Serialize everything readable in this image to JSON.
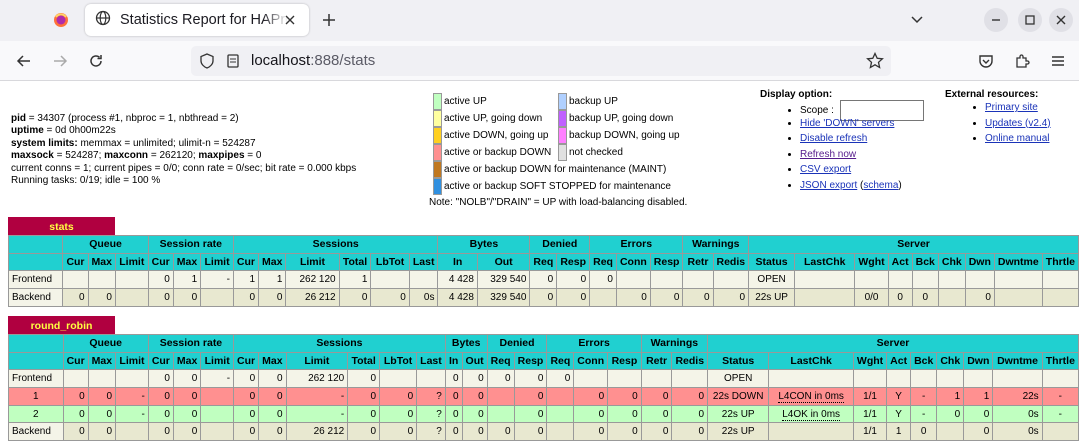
{
  "browser": {
    "tab_title": "Statistics Report for HAProxy",
    "url_host": "localhost",
    "url_rest": ":888/stats"
  },
  "info_lines": [
    {
      "b": "pid",
      "t": " = 34307 (process #1, nbproc = 1, nbthread = 2)"
    },
    {
      "b": "uptime",
      "t": " = 0d 0h00m22s"
    },
    {
      "b": "system limits:",
      "t": " memmax = unlimited; ulimit-n = 524287"
    },
    {
      "b": "maxsock",
      "t": " = 524287; ",
      "b2": "maxconn",
      "t2": " = 262120; ",
      "b3": "maxpipes",
      "t3": " = 0"
    },
    {
      "t": "current conns = 1; current pipes = 0/0; conn rate = 0/sec; bit rate = 0.000 kbps"
    },
    {
      "t": "Running tasks: 0/19; idle = 100 %"
    }
  ],
  "legend_left": [
    {
      "label": "active UP",
      "color": "#c0ffc0"
    },
    {
      "label": "active UP, going down",
      "color": "#ffffa0"
    },
    {
      "label": "active DOWN, going up",
      "color": "#ffd020"
    },
    {
      "label": "active or backup DOWN",
      "color": "#ff9090"
    },
    {
      "label": "active or backup DOWN for maintenance (MAINT)",
      "color": "#c07820"
    },
    {
      "label": "active or backup SOFT STOPPED for maintenance",
      "color": "#3090e0"
    }
  ],
  "legend_right": [
    {
      "label": "backup UP",
      "color": "#b0d0ff"
    },
    {
      "label": "backup UP, going down",
      "color": "#c060ff"
    },
    {
      "label": "backup DOWN, going up",
      "color": "#ff80ff"
    },
    {
      "label": "not checked",
      "color": "#e0e0e0"
    }
  ],
  "note": "Note: \"NOLB\"/\"DRAIN\" = UP with load-balancing disabled.",
  "display": {
    "title": "Display option:",
    "scope_label": "Scope : ",
    "links": [
      "Hide 'DOWN' servers",
      "Disable refresh",
      "Refresh now",
      "CSV export",
      "JSON export"
    ],
    "schema": "schema"
  },
  "external": {
    "title": "External resources:",
    "links": [
      "Primary site",
      "Updates (v2.4)",
      "Online manual"
    ]
  },
  "stats": {
    "name": "stats",
    "groups": [
      "",
      "Queue",
      "Session rate",
      "Sessions",
      "Bytes",
      "Denied",
      "Errors",
      "Warnings",
      "Server"
    ],
    "cols": [
      "",
      "Cur",
      "Max",
      "Limit",
      "Cur",
      "Max",
      "Limit",
      "Cur",
      "Max",
      "Limit",
      "Total",
      "LbTot",
      "Last",
      "In",
      "Out",
      "Req",
      "Resp",
      "Req",
      "Conn",
      "Resp",
      "Retr",
      "Redis",
      "Status",
      "LastChk",
      "Wght",
      "Act",
      "Bck",
      "Chk",
      "Dwn",
      "Dwntme",
      "Thrtle"
    ],
    "rows": [
      {
        "cls": "fe",
        "cells": [
          "Frontend",
          "",
          "",
          "",
          "0",
          "1",
          "-",
          "1",
          "1",
          "262 120",
          "1",
          "",
          "",
          "4 428",
          "329 540",
          "0",
          "0",
          "0",
          "",
          "",
          "",
          "",
          "OPEN",
          "",
          "",
          "",
          "",
          "",
          "",
          "",
          ""
        ]
      },
      {
        "cls": "be",
        "cells": [
          "Backend",
          "0",
          "0",
          "",
          "0",
          "0",
          "",
          "0",
          "0",
          "26 212",
          "0",
          "0",
          "0s",
          "4 428",
          "329 540",
          "0",
          "0",
          "",
          "0",
          "0",
          "0",
          "0",
          "22s UP",
          "",
          "0/0",
          "0",
          "0",
          "",
          "0",
          "",
          ""
        ]
      }
    ]
  },
  "rr": {
    "name": "round_robin",
    "groups": [
      "",
      "Queue",
      "Session rate",
      "Sessions",
      "Bytes",
      "Denied",
      "Errors",
      "Warnings",
      "Server"
    ],
    "cols": [
      "",
      "Cur",
      "Max",
      "Limit",
      "Cur",
      "Max",
      "Limit",
      "Cur",
      "Max",
      "Limit",
      "Total",
      "LbTot",
      "Last",
      "In",
      "Out",
      "Req",
      "Resp",
      "Req",
      "Conn",
      "Resp",
      "Retr",
      "Redis",
      "Status",
      "LastChk",
      "Wght",
      "Act",
      "Bck",
      "Chk",
      "Dwn",
      "Dwntme",
      "Thrtle"
    ],
    "rows": [
      {
        "cls": "fe",
        "cells": [
          "Frontend",
          "",
          "",
          "",
          "0",
          "0",
          "-",
          "0",
          "0",
          "262 120",
          "0",
          "",
          "",
          "0",
          "0",
          "0",
          "0",
          "0",
          "",
          "",
          "",
          "",
          "OPEN",
          "",
          "",
          "",
          "",
          "",
          "",
          "",
          ""
        ]
      },
      {
        "cls": "down",
        "cells": [
          "1",
          "0",
          "0",
          "-",
          "0",
          "0",
          "",
          "0",
          "0",
          "-",
          "0",
          "0",
          "?",
          "0",
          "0",
          "",
          "0",
          "",
          "0",
          "0",
          "0",
          "0",
          "22s DOWN",
          "L4CON in 0ms",
          "1/1",
          "Y",
          "-",
          "1",
          "1",
          "22s",
          "-"
        ]
      },
      {
        "cls": "up",
        "cells": [
          "2",
          "0",
          "0",
          "-",
          "0",
          "0",
          "",
          "0",
          "0",
          "-",
          "0",
          "0",
          "?",
          "0",
          "0",
          "",
          "0",
          "",
          "0",
          "0",
          "0",
          "0",
          "22s UP",
          "L4OK in 0ms",
          "1/1",
          "Y",
          "-",
          "0",
          "0",
          "0s",
          "-"
        ]
      },
      {
        "cls": "be",
        "cells": [
          "Backend",
          "0",
          "0",
          "",
          "0",
          "0",
          "",
          "0",
          "0",
          "26 212",
          "0",
          "0",
          "?",
          "0",
          "0",
          "0",
          "0",
          "",
          "0",
          "0",
          "0",
          "0",
          "22s UP",
          "",
          "1/1",
          "1",
          "0",
          "",
          "0",
          "0s",
          ""
        ]
      }
    ]
  }
}
